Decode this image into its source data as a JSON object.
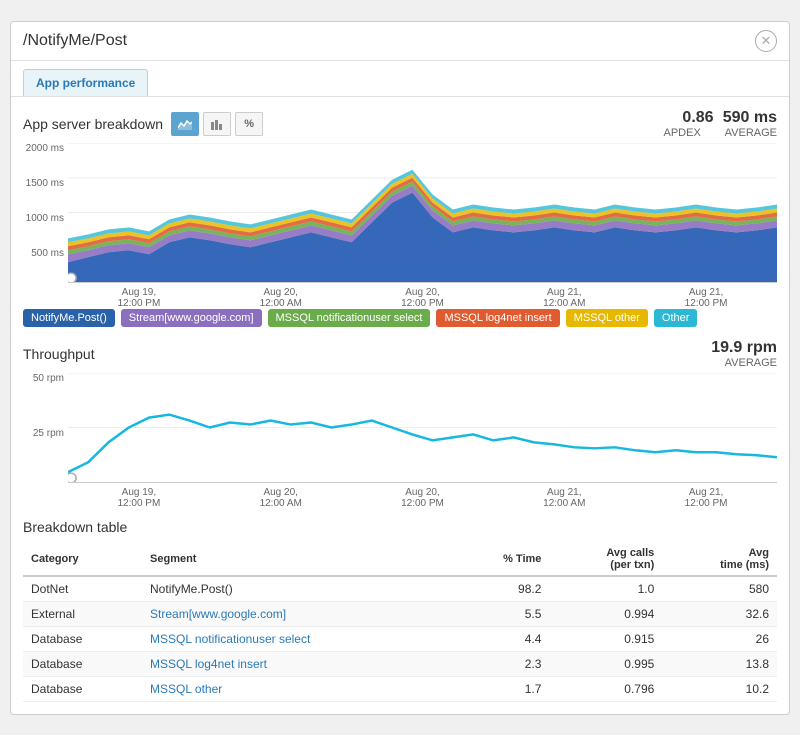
{
  "window": {
    "title": "/NotifyMe/Post",
    "close_label": "✕"
  },
  "tabs": [
    {
      "label": "App performance",
      "active": true
    }
  ],
  "app_server_breakdown": {
    "title": "App server breakdown",
    "apdex_label": "APDEX",
    "apdex_value": "0.86",
    "average_label": "AVERAGE",
    "average_value": "590 ms",
    "icons": [
      "area-icon",
      "bar-icon",
      "percent-icon"
    ],
    "y_labels": [
      "2000 ms",
      "1500 ms",
      "1000 ms",
      "500 ms",
      ""
    ],
    "x_labels": [
      "Aug 19,\n12:00 PM",
      "Aug 20,\n12:00 AM",
      "Aug 20,\n12:00 PM",
      "Aug 21,\n12:00 AM",
      "Aug 21,\n12:00 PM"
    ]
  },
  "legend": [
    {
      "label": "NotifyMe.Post()",
      "color": "#2962a8"
    },
    {
      "label": "Stream[www.google.com]",
      "color": "#8b6fbf"
    },
    {
      "label": "MSSQL notificationuser select",
      "color": "#6aab4a"
    },
    {
      "label": "MSSQL log4net insert",
      "color": "#e05c30"
    },
    {
      "label": "MSSQL other",
      "color": "#e6b800"
    },
    {
      "label": "Other",
      "color": "#2ab8d4"
    }
  ],
  "throughput": {
    "title": "Throughput",
    "average_label": "AVERAGE",
    "average_value": "19.9 rpm",
    "y_labels": [
      "50 rpm",
      "25 rpm",
      ""
    ],
    "x_labels": [
      "Aug 19,\n12:00 PM",
      "Aug 20,\n12:00 AM",
      "Aug 20,\n12:00 PM",
      "Aug 21,\n12:00 AM",
      "Aug 21,\n12:00 PM"
    ]
  },
  "breakdown_table": {
    "title": "Breakdown table",
    "columns": [
      {
        "label": "Category"
      },
      {
        "label": "Segment"
      },
      {
        "label": "% Time",
        "align": "right"
      },
      {
        "label": "Avg calls\n(per txn)",
        "align": "right"
      },
      {
        "label": "Avg\ntime (ms)",
        "align": "right"
      }
    ],
    "rows": [
      {
        "category": "DotNet",
        "segment": "NotifyMe.Post()",
        "segment_link": false,
        "pct_time": "98.2",
        "avg_calls": "1.0",
        "avg_time": "580"
      },
      {
        "category": "External",
        "segment": "Stream[www.google.com]",
        "segment_link": true,
        "pct_time": "5.5",
        "avg_calls": "0.994",
        "avg_time": "32.6"
      },
      {
        "category": "Database",
        "segment": "MSSQL notificationuser select",
        "segment_link": true,
        "pct_time": "4.4",
        "avg_calls": "0.915",
        "avg_time": "26"
      },
      {
        "category": "Database",
        "segment": "MSSQL log4net insert",
        "segment_link": true,
        "pct_time": "2.3",
        "avg_calls": "0.995",
        "avg_time": "13.8"
      },
      {
        "category": "Database",
        "segment": "MSSQL other",
        "segment_link": true,
        "pct_time": "1.7",
        "avg_calls": "0.796",
        "avg_time": "10.2"
      }
    ]
  }
}
